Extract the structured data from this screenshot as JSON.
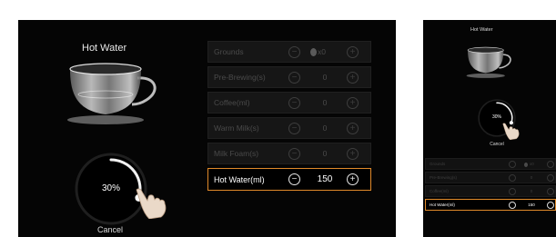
{
  "landscape": {
    "title": "Hot Water",
    "progress": {
      "percent_label": "30%",
      "value": 0.3
    },
    "cancel_label": "Cancel",
    "rows": [
      {
        "label": "Grounds",
        "value": "x0",
        "bean": true,
        "active": false
      },
      {
        "label": "Pre-Brewing(s)",
        "value": "0",
        "bean": false,
        "active": false
      },
      {
        "label": "Coffee(ml)",
        "value": "0",
        "bean": false,
        "active": false
      },
      {
        "label": "Warm Milk(s)",
        "value": "0",
        "bean": false,
        "active": false
      },
      {
        "label": "Milk Foam(s)",
        "value": "0",
        "bean": false,
        "active": false
      },
      {
        "label": "Hot Water(ml)",
        "value": "150",
        "bean": false,
        "active": true
      }
    ]
  },
  "portrait": {
    "title": "Hot Water",
    "progress": {
      "percent_label": "30%",
      "value": 0.3
    },
    "cancel_label": "Cancel",
    "rows": [
      {
        "label": "Grounds",
        "value": "x0",
        "bean": true,
        "active": false
      },
      {
        "label": "Pre-Brewing(s)",
        "value": "0",
        "bean": false,
        "active": false
      },
      {
        "label": "Coffee(ml)",
        "value": "0",
        "bean": false,
        "active": false
      },
      {
        "label": "Hot Water(ml)",
        "value": "150",
        "bean": false,
        "active": true
      }
    ]
  },
  "colors": {
    "accent": "#e08a2a",
    "background": "#050505",
    "dim_text": "#4a4a4a"
  }
}
